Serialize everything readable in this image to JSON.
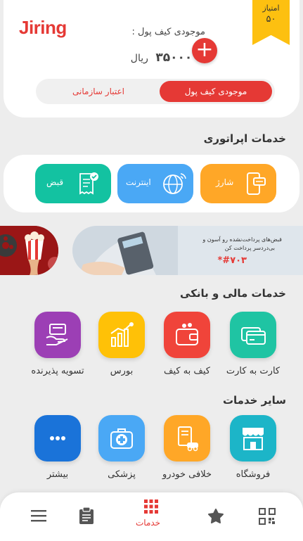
{
  "header": {
    "logo": "Jiring",
    "points_label": "امتیاز",
    "points_value": "۵۰",
    "wallet_label": "موجودی کیف پول :",
    "wallet_amount": "۳۵۰۰۰۰۰",
    "wallet_currency": "ریال",
    "tab_wallet": "موجودی کیف پول",
    "tab_credit": "اعتبار سازمانی"
  },
  "operator": {
    "title": "خدمات اپراتوری",
    "charge": "شارژ",
    "internet": "اینترنت",
    "bill": "قبض"
  },
  "banner": {
    "line1": "قبض‌های پرداخت‌نشده رو آسون و",
    "line2": "بی‌دردسر پرداخت کن",
    "code": "#۷۰۳*"
  },
  "financial": {
    "title": "خدمات مالی و بانکی",
    "items": [
      {
        "label": "کارت به کارت",
        "color": "#1fc4a3",
        "icon": "card-transfer-icon"
      },
      {
        "label": "کیف به کیف",
        "color": "#f0443a",
        "icon": "wallet-transfer-icon"
      },
      {
        "label": "بورس",
        "color": "#ffc107",
        "icon": "stock-chart-icon"
      },
      {
        "label": "تسویه پذیرنده",
        "color": "#9c3fb5",
        "icon": "settlement-icon"
      }
    ]
  },
  "other": {
    "title": "سایر خدمات",
    "items": [
      {
        "label": "فروشگاه",
        "color": "#1cb5c8",
        "icon": "store-icon"
      },
      {
        "label": "خلافی خودرو",
        "color": "#ffa727",
        "icon": "car-fine-icon"
      },
      {
        "label": "پزشکی",
        "color": "#4aa8f5",
        "icon": "medical-kit-icon"
      },
      {
        "label": "بیشتر",
        "color": "#1a73d9",
        "icon": "more-dots-icon"
      }
    ]
  },
  "nav": {
    "services_label": "خدمات",
    "active_color": "#e53935"
  }
}
